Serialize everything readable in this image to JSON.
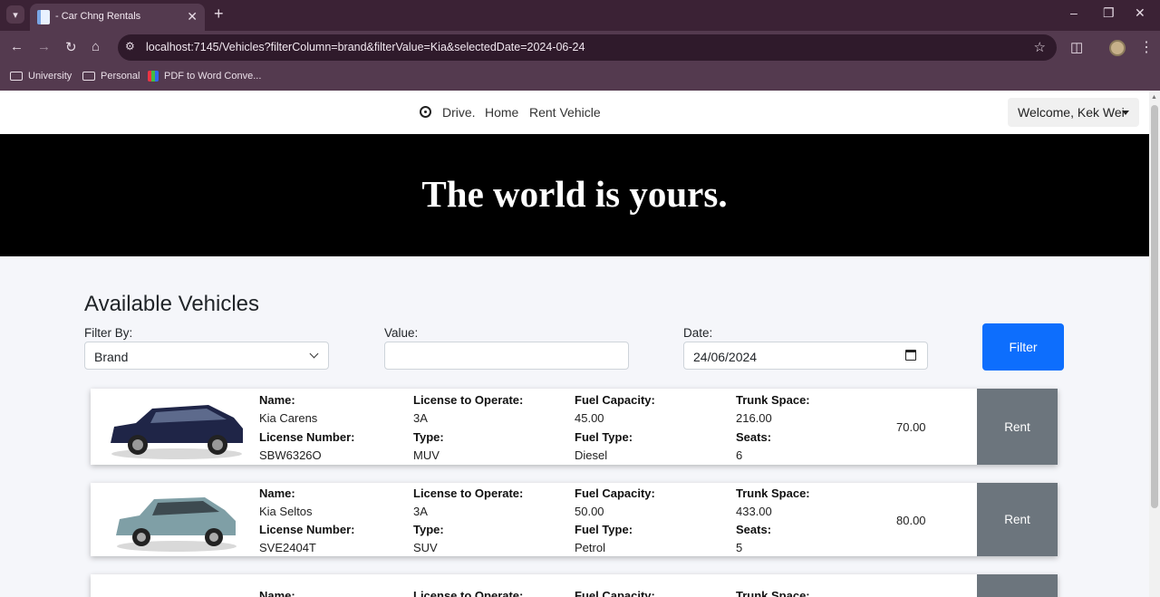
{
  "browser": {
    "tab_title": "- Car Chng Rentals",
    "url": "localhost:7145/Vehicles?filterColumn=brand&filterValue=Kia&selectedDate=2024-06-24",
    "bookmarks": [
      "University",
      "Personal",
      "PDF to Word Conve..."
    ]
  },
  "navbar": {
    "brand": "Drive.",
    "links": [
      "Home",
      "Rent Vehicle"
    ],
    "welcome": "Welcome, Kek Wei"
  },
  "hero": {
    "text": "The world is yours."
  },
  "filters": {
    "title": "Available Vehicles",
    "filter_by_label": "Filter By:",
    "filter_by_value": "Brand",
    "value_label": "Value:",
    "value_value": "",
    "date_label": "Date:",
    "date_value": "24/06/2024",
    "button": "Filter"
  },
  "labels": {
    "name": "Name:",
    "license_number": "License Number:",
    "license_to_operate": "License to Operate:",
    "type": "Type:",
    "fuel_capacity": "Fuel Capacity:",
    "fuel_type": "Fuel Type:",
    "trunk_space": "Trunk Space:",
    "seats": "Seats:",
    "rent": "Rent"
  },
  "vehicles": [
    {
      "name": "Kia Carens",
      "license_number": "SBW6326O",
      "license_to_operate": "3A",
      "type": "MUV",
      "fuel_capacity": "45.00",
      "fuel_type": "Diesel",
      "trunk_space": "216.00",
      "seats": "6",
      "price": "70.00",
      "color": "#1f2547"
    },
    {
      "name": "Kia Seltos",
      "license_number": "SVE2404T",
      "license_to_operate": "3A",
      "type": "SUV",
      "fuel_capacity": "50.00",
      "fuel_type": "Petrol",
      "trunk_space": "433.00",
      "seats": "5",
      "price": "80.00",
      "color": "#7f9fa6"
    }
  ]
}
